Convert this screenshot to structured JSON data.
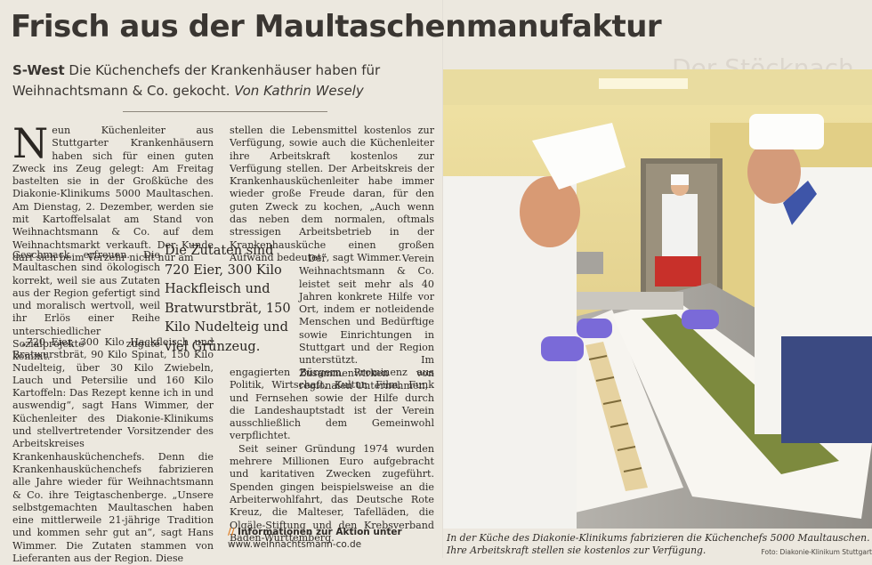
{
  "headline": "Frisch aus der Maultaschenmanufaktur",
  "bleed_text": "Der Stöcknach öffnet seinen eigenen Adventskalender",
  "deck": {
    "rubric": "S-West",
    "text": "Die Küchenchefs der Krankenhäuser haben für Weihnachtsmann & Co. gekocht.",
    "author": "Von Kathrin Wesely"
  },
  "body": {
    "dropcap": "N",
    "p1a": "eun Küchenleiter aus Stuttgarter Krankenhäusern haben sich für einen guten Zweck ins Zeug gelegt: Am Freitag bastelten sie in der Großküche des Diakonie-Klinikums 5000 Maultaschen. Am Dienstag, 2. Dezember, werden sie mit Kartoffelsalat am Stand von Weihnachtsmann & Co. auf dem Weihnachtsmarkt verkauft. Der Kunde darf sich beim Verzehr nicht nur am",
    "p1b": "Geschmack erfreuen. Die Maultaschen sind ökologisch korrekt, weil sie aus Zutaten aus der Region gefertigt sind und moralisch wertvoll, weil ihr Erlös einer Reihe unterschiedlicher Sozialprojekte zugute kommt.",
    "p2": "„720 Eier, 300 Kilo Hackfleisch und Bratwurstbrät, 90 Kilo Spinat, 150 Kilo Nudelteig, über 30 Kilo Zwiebeln, Lauch und Petersilie und 160 Kilo Kartoffeln: Das Rezept kenne ich in und auswendig“, sagt Hans Wimmer, der Küchenleiter des Diakonie-Klinikums und stellvertretender Vorsitzender des Arbeitskreises Krankenhausküchenchefs. Denn die Krankenhausküchenchefs fabrizieren alle Jahre wieder für Weihnachtsmann & Co. ihre Teigtaschenberge. „Unsere selbstgemachten Maultaschen haben eine mittlerweile 21-jährige Tradition und kommen sehr gut an“, sagt Hans Wimmer. Die Zutaten stammen von Lieferanten aus der Region. Diese",
    "p3a": "stellen die Lebensmittel kostenlos zur Verfügung, sowie auch die Küchenleiter ihre Arbeitskraft kostenlos zur Verfügung stellen. Der Arbeitskreis der Krankenhausküchenleiter habe immer wieder große Freude daran, für den guten Zweck zu kochen, „Auch wenn das neben dem normalen, oftmals stressigen Arbeitsbetrieb in der Krankenhausküche einen großen Aufwand bedeutet“, sagt Wimmer.",
    "p4a": "Der Verein Weihnachtsmann & Co. leistet seit mehr als 40 Jahren konkrete Hilfe vor Ort, indem er notleidende Menschen und Bedürftige sowie Einrichtungen in Stuttgart und der Region unterstützt. Im Zusammenwirken von regionalen Unternehmen,",
    "p4b": "engagierten Bürgern, Prominenz aus Politik, Wirtschaft, Kultur, Film, Funk und Fernsehen sowie der Hilfe durch die Landeshauptstadt ist der Verein ausschließlich dem Gemeinwohl verpflichtet.",
    "p5": "Seit seiner Gründung 1974 wurden mehrere Millionen Euro aufgebracht und karitativen Zwecken zugeführt. Spenden gingen beispielsweise an die Arbeiterwohlfahrt, das Deutsche Rote Kreuz, die Malteser, Tafelläden, die Olgäle-Stiftung und den Krebsverband Baden-Württemberg."
  },
  "pullquote": "Die Zutaten sind 720 Eier, 300 Kilo Hackfleisch und Bratwurstbrät, 150 Kilo Nudelteig und viel Grünzeug.",
  "info": {
    "marker": "//",
    "label": "Informationen zur Aktion unter",
    "url": "www.weihnachtsmann-co.de"
  },
  "caption": "In der Küche des Diakonie-Klinikums fabrizieren die Küchenchefs 5000 Maultauschen. Ihre Arbeitskraft stellen sie kostenlos zur Verfügung.",
  "credit": "Foto: Diakonie-Klinikum Stuttgart",
  "colors": {
    "paper": "#ece8df",
    "ink": "#2a2622",
    "info_marker": "#e07a1c",
    "glove": "#7a6ad8",
    "filling": "#7d8a3e"
  }
}
